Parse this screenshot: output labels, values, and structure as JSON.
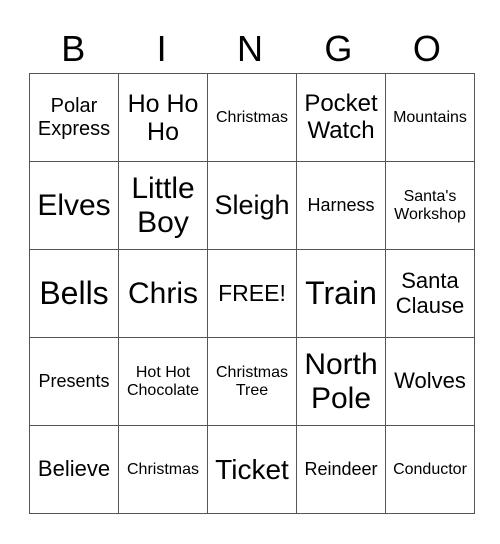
{
  "header": [
    "B",
    "I",
    "N",
    "G",
    "O"
  ],
  "rows": [
    [
      "Polar Express",
      "Ho Ho Ho",
      "Christmas",
      "Pocket Watch",
      "Mountains"
    ],
    [
      "Elves",
      "Little Boy",
      "Sleigh",
      "Harness",
      "Santa's Workshop"
    ],
    [
      "Bells",
      "Chris",
      "FREE!",
      "Train",
      "Santa Clause"
    ],
    [
      "Presents",
      "Hot Hot Chocolate",
      "Christmas Tree",
      "North Pole",
      "Wolves"
    ],
    [
      "Believe",
      "Christmas",
      "Ticket",
      "Reindeer",
      "Conductor"
    ]
  ]
}
